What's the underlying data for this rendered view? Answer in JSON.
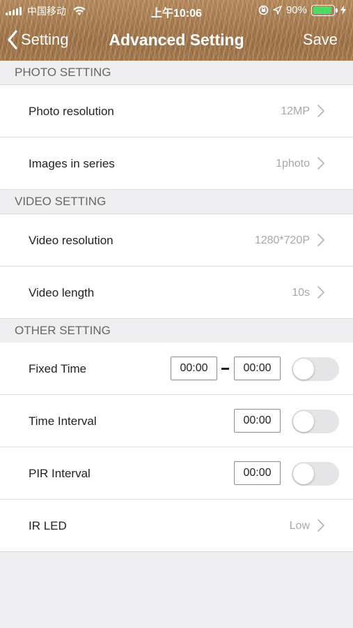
{
  "status_bar": {
    "carrier": "中国移动",
    "time": "上午10:06",
    "battery": "90%",
    "battery_level": 0.9
  },
  "nav": {
    "back_label": "Setting",
    "title": "Advanced Setting",
    "save_label": "Save"
  },
  "photo_section": {
    "header": "PHOTO SETTING",
    "photo_resolution": {
      "label": "Photo resolution",
      "value": "12MP"
    },
    "images_in_series": {
      "label": "Images in series",
      "value": "1photo"
    }
  },
  "video_section": {
    "header": "VIDEO SETTING",
    "video_resolution": {
      "label": "Video resolution",
      "value": "1280*720P"
    },
    "video_length": {
      "label": "Video length",
      "value": "10s"
    }
  },
  "other_section": {
    "header": "OTHER SETTING",
    "fixed_time": {
      "label": "Fixed Time",
      "start": "00:00",
      "end": "00:00",
      "enabled": false
    },
    "time_interval": {
      "label": "Time Interval",
      "value": "00:00",
      "enabled": false
    },
    "pir_interval": {
      "label": "PIR Interval",
      "value": "00:00",
      "enabled": false
    },
    "ir_led": {
      "label": "IR LED",
      "value": "Low"
    }
  },
  "colors": {
    "battery_green": "#4cd964",
    "toggle_off": "#e5e5e8",
    "value_gray": "#a8a8ac",
    "background": "#eeeef0"
  }
}
